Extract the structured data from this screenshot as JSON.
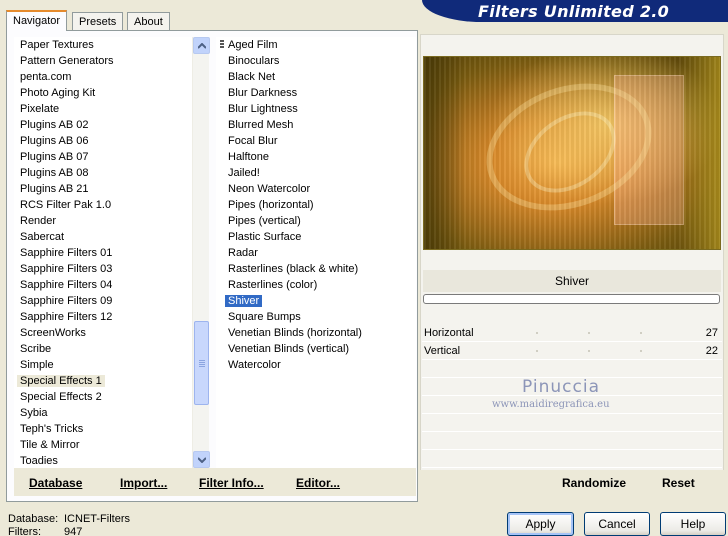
{
  "tabs": [
    "Navigator",
    "Presets",
    "About"
  ],
  "app_title": "Filters Unlimited 2.0",
  "categories": [
    "Paper Textures",
    "Pattern Generators",
    "penta.com",
    "Photo Aging Kit",
    "Pixelate",
    "Plugins AB 02",
    "Plugins AB 06",
    "Plugins AB 07",
    "Plugins AB 08",
    "Plugins AB 21",
    "RCS Filter Pak 1.0",
    "Render",
    "Sabercat",
    "Sapphire Filters 01",
    "Sapphire Filters 03",
    "Sapphire Filters 04",
    "Sapphire Filters 09",
    "Sapphire Filters 12",
    "ScreenWorks",
    "Scribe",
    "Simple",
    "Special Effects 1",
    "Special Effects 2",
    "Sybia",
    "Teph's Tricks",
    "Tile & Mirror",
    "Toadies"
  ],
  "selected_category": "Special Effects 1",
  "filters": [
    "Aged Film",
    "Binoculars",
    "Black Net",
    "Blur Darkness",
    "Blur Lightness",
    "Blurred Mesh",
    "Focal Blur",
    "Halftone",
    "Jailed!",
    "Neon Watercolor",
    "Pipes (horizontal)",
    "Pipes (vertical)",
    "Plastic Surface",
    "Radar",
    "Rasterlines (black & white)",
    "Rasterlines (color)",
    "Shiver",
    "Square Bumps",
    "Venetian Blinds (horizontal)",
    "Venetian Blinds (vertical)",
    "Watercolor"
  ],
  "selected_filter": "Shiver",
  "left_buttons": {
    "database": "Database",
    "import": "Import...",
    "filter_info": "Filter Info...",
    "editor": "Editor..."
  },
  "preview": {
    "filter_name": "Shiver"
  },
  "params": [
    {
      "label": "Horizontal",
      "value": "27"
    },
    {
      "label": "Vertical",
      "value": "22"
    }
  ],
  "watermark": {
    "name": "Pinuccia",
    "site": "www.maidiregrafica.eu"
  },
  "right_buttons": {
    "randomize": "Randomize",
    "reset": "Reset"
  },
  "status": {
    "database_label": "Database:",
    "database_value": "ICNET-Filters",
    "filters_label": "Filters:",
    "filters_value": "947"
  },
  "dialog_buttons": {
    "apply": "Apply",
    "cancel": "Cancel",
    "help": "Help"
  }
}
